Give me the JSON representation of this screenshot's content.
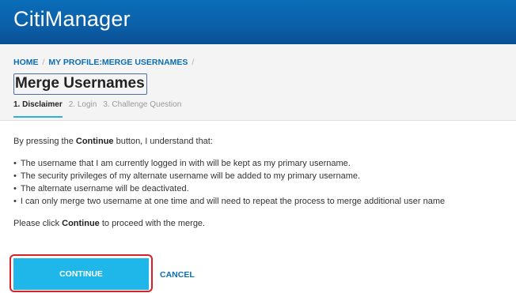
{
  "app": {
    "title": "CitiManager"
  },
  "breadcrumb": {
    "home": "HOME",
    "separator": "/",
    "current": "MY PROFILE:MERGE USERNAMES",
    "trailing_separator": "/"
  },
  "page": {
    "title": "Merge Usernames"
  },
  "steps": [
    {
      "label": "1. Disclaimer",
      "active": true
    },
    {
      "label": "2. Login",
      "active": false
    },
    {
      "label": "3. Challenge Question",
      "active": false
    }
  ],
  "content": {
    "intro_prefix": "By pressing the ",
    "intro_bold": "Continue",
    "intro_suffix": " button, I understand that:",
    "points": [
      "The username that I am currently logged in with will be kept as my primary username.",
      "The security privileges of my alternate username will be added to my primary username.",
      "The alternate username will be deactivated.",
      "I can only merge two username at one time and will need to repeat the process to merge additional user name"
    ],
    "outro_prefix": "Please click ",
    "outro_bold": "Continue",
    "outro_suffix": " to proceed with the merge."
  },
  "actions": {
    "continue_label": "CONTINUE",
    "cancel_label": "CANCEL"
  },
  "colors": {
    "header_blue": "#0b5fa8",
    "link_blue": "#0b6db3",
    "button_cyan": "#1fb7e9",
    "active_step_underline": "#2cb0e0",
    "annotation_red": "#d6202a"
  }
}
